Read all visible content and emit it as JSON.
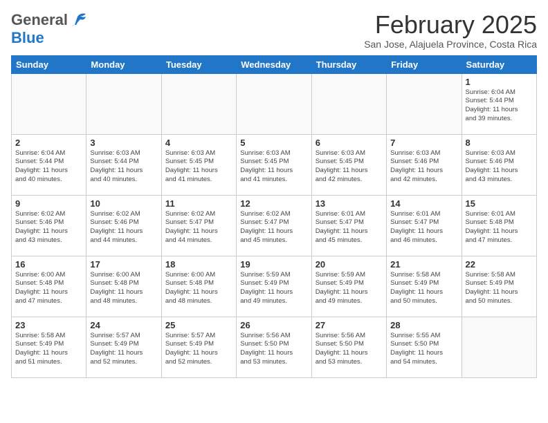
{
  "header": {
    "logo_general": "General",
    "logo_blue": "Blue",
    "month_title": "February 2025",
    "subtitle": "San Jose, Alajuela Province, Costa Rica"
  },
  "weekdays": [
    "Sunday",
    "Monday",
    "Tuesday",
    "Wednesday",
    "Thursday",
    "Friday",
    "Saturday"
  ],
  "weeks": [
    [
      {
        "day": "",
        "info": ""
      },
      {
        "day": "",
        "info": ""
      },
      {
        "day": "",
        "info": ""
      },
      {
        "day": "",
        "info": ""
      },
      {
        "day": "",
        "info": ""
      },
      {
        "day": "",
        "info": ""
      },
      {
        "day": "1",
        "info": "Sunrise: 6:04 AM\nSunset: 5:44 PM\nDaylight: 11 hours\nand 39 minutes."
      }
    ],
    [
      {
        "day": "2",
        "info": "Sunrise: 6:04 AM\nSunset: 5:44 PM\nDaylight: 11 hours\nand 40 minutes."
      },
      {
        "day": "3",
        "info": "Sunrise: 6:03 AM\nSunset: 5:44 PM\nDaylight: 11 hours\nand 40 minutes."
      },
      {
        "day": "4",
        "info": "Sunrise: 6:03 AM\nSunset: 5:45 PM\nDaylight: 11 hours\nand 41 minutes."
      },
      {
        "day": "5",
        "info": "Sunrise: 6:03 AM\nSunset: 5:45 PM\nDaylight: 11 hours\nand 41 minutes."
      },
      {
        "day": "6",
        "info": "Sunrise: 6:03 AM\nSunset: 5:45 PM\nDaylight: 11 hours\nand 42 minutes."
      },
      {
        "day": "7",
        "info": "Sunrise: 6:03 AM\nSunset: 5:46 PM\nDaylight: 11 hours\nand 42 minutes."
      },
      {
        "day": "8",
        "info": "Sunrise: 6:03 AM\nSunset: 5:46 PM\nDaylight: 11 hours\nand 43 minutes."
      }
    ],
    [
      {
        "day": "9",
        "info": "Sunrise: 6:02 AM\nSunset: 5:46 PM\nDaylight: 11 hours\nand 43 minutes."
      },
      {
        "day": "10",
        "info": "Sunrise: 6:02 AM\nSunset: 5:46 PM\nDaylight: 11 hours\nand 44 minutes."
      },
      {
        "day": "11",
        "info": "Sunrise: 6:02 AM\nSunset: 5:47 PM\nDaylight: 11 hours\nand 44 minutes."
      },
      {
        "day": "12",
        "info": "Sunrise: 6:02 AM\nSunset: 5:47 PM\nDaylight: 11 hours\nand 45 minutes."
      },
      {
        "day": "13",
        "info": "Sunrise: 6:01 AM\nSunset: 5:47 PM\nDaylight: 11 hours\nand 45 minutes."
      },
      {
        "day": "14",
        "info": "Sunrise: 6:01 AM\nSunset: 5:47 PM\nDaylight: 11 hours\nand 46 minutes."
      },
      {
        "day": "15",
        "info": "Sunrise: 6:01 AM\nSunset: 5:48 PM\nDaylight: 11 hours\nand 47 minutes."
      }
    ],
    [
      {
        "day": "16",
        "info": "Sunrise: 6:00 AM\nSunset: 5:48 PM\nDaylight: 11 hours\nand 47 minutes."
      },
      {
        "day": "17",
        "info": "Sunrise: 6:00 AM\nSunset: 5:48 PM\nDaylight: 11 hours\nand 48 minutes."
      },
      {
        "day": "18",
        "info": "Sunrise: 6:00 AM\nSunset: 5:48 PM\nDaylight: 11 hours\nand 48 minutes."
      },
      {
        "day": "19",
        "info": "Sunrise: 5:59 AM\nSunset: 5:49 PM\nDaylight: 11 hours\nand 49 minutes."
      },
      {
        "day": "20",
        "info": "Sunrise: 5:59 AM\nSunset: 5:49 PM\nDaylight: 11 hours\nand 49 minutes."
      },
      {
        "day": "21",
        "info": "Sunrise: 5:58 AM\nSunset: 5:49 PM\nDaylight: 11 hours\nand 50 minutes."
      },
      {
        "day": "22",
        "info": "Sunrise: 5:58 AM\nSunset: 5:49 PM\nDaylight: 11 hours\nand 50 minutes."
      }
    ],
    [
      {
        "day": "23",
        "info": "Sunrise: 5:58 AM\nSunset: 5:49 PM\nDaylight: 11 hours\nand 51 minutes."
      },
      {
        "day": "24",
        "info": "Sunrise: 5:57 AM\nSunset: 5:49 PM\nDaylight: 11 hours\nand 52 minutes."
      },
      {
        "day": "25",
        "info": "Sunrise: 5:57 AM\nSunset: 5:49 PM\nDaylight: 11 hours\nand 52 minutes."
      },
      {
        "day": "26",
        "info": "Sunrise: 5:56 AM\nSunset: 5:50 PM\nDaylight: 11 hours\nand 53 minutes."
      },
      {
        "day": "27",
        "info": "Sunrise: 5:56 AM\nSunset: 5:50 PM\nDaylight: 11 hours\nand 53 minutes."
      },
      {
        "day": "28",
        "info": "Sunrise: 5:55 AM\nSunset: 5:50 PM\nDaylight: 11 hours\nand 54 minutes."
      },
      {
        "day": "",
        "info": ""
      }
    ]
  ]
}
